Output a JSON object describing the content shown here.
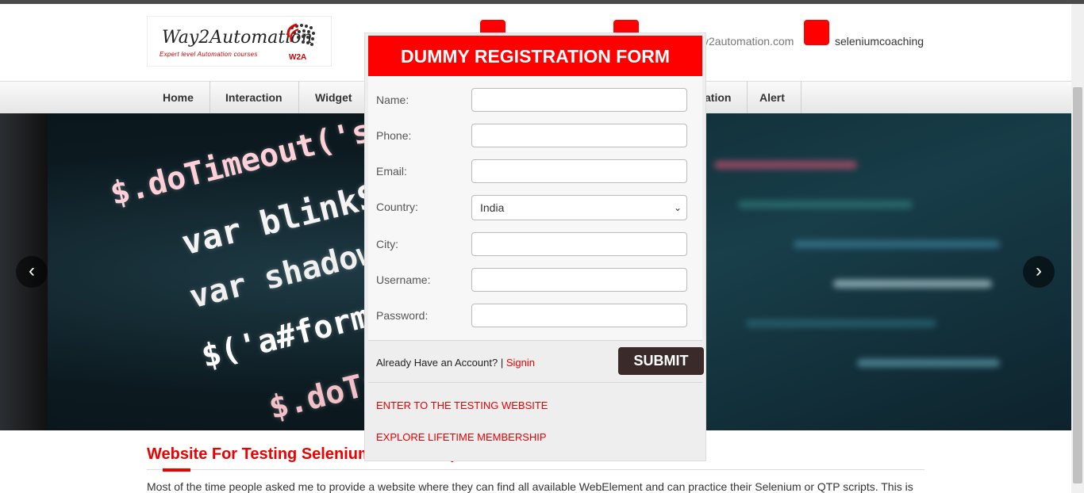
{
  "header": {
    "logo_main": "Way2Automation",
    "logo_sub": "Expert level Automation courses",
    "logo_mark": "W2A",
    "contact_email_partial": "y2automation.com",
    "contact_skype": "seleniumcoaching"
  },
  "nav": {
    "items": [
      "Home",
      "Interaction",
      "Widget",
      "ation",
      "Alert"
    ]
  },
  "hero": {
    "code_lines": [
      "$.doTimeout('scro",
      "var blinkSpe",
      "var shadowT",
      "$('a#form_s",
      "$.doTi"
    ],
    "prev_label": "‹",
    "next_label": "›"
  },
  "content": {
    "title_visible": "Website For Testing Selenium",
    "title_tail": "p",
    "paragraph": "Most of the time people asked me to provide a website where they can find all available WebElement and can practice their Selenium or QTP scripts. This is"
  },
  "modal": {
    "title": "DUMMY REGISTRATION FORM",
    "fields": {
      "name_label": "Name:",
      "phone_label": "Phone:",
      "email_label": "Email:",
      "country_label": "Country:",
      "country_value": "India",
      "city_label": "City:",
      "username_label": "Username:",
      "password_label": "Password:"
    },
    "already_text": "Already Have an Account? |",
    "signin_label": "Signin",
    "submit_label": "SUBMIT",
    "link_enter": "ENTER TO THE TESTING WEBSITE",
    "link_membership": "EXPLORE LIFETIME MEMBERSHIP"
  },
  "colors": {
    "brand_red": "#ff0000",
    "submit_bg": "#3a2a2a"
  }
}
